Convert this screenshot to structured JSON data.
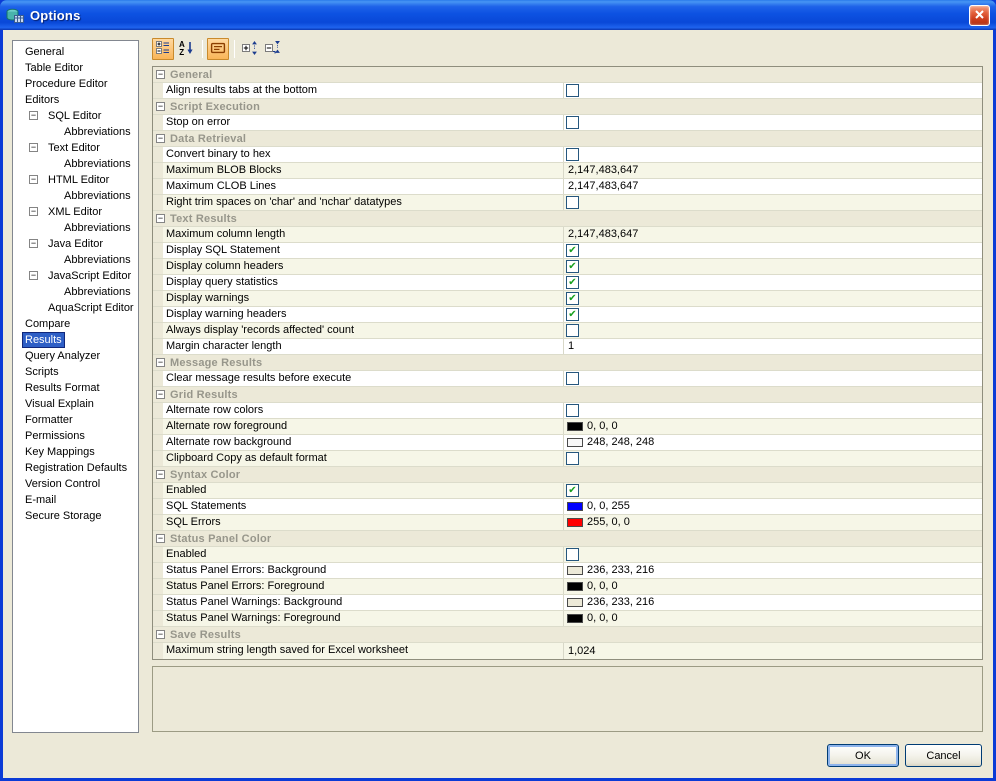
{
  "window": {
    "title": "Options"
  },
  "colors": {
    "dialog_bg": "#ECE9D8",
    "titlebar_blue": "#0D52E2",
    "selection_blue": "#2E5FC6",
    "row_alt_cream": "#F6F6E7",
    "section_header_text": "#97968B",
    "check_green": "#17A01F"
  },
  "titlebar": {
    "icon": "app-database-icon",
    "close_icon": "close-x-icon"
  },
  "toolbar": {
    "buttons": [
      {
        "name": "categorized-view",
        "icon": "categorized-icon",
        "active": true
      },
      {
        "name": "alphabetical-sort",
        "icon": "az-sort-icon",
        "active": false
      },
      {
        "name": "separator"
      },
      {
        "name": "show-description",
        "icon": "description-icon",
        "active": true
      },
      {
        "name": "separator"
      },
      {
        "name": "expand-all",
        "icon": "expand-all-icon",
        "active": false
      },
      {
        "name": "collapse-all",
        "icon": "collapse-all-icon",
        "active": false
      }
    ]
  },
  "sidebar": {
    "items": [
      {
        "label": "General",
        "level": 0
      },
      {
        "label": "Table Editor",
        "level": 0
      },
      {
        "label": "Procedure Editor",
        "level": 0
      },
      {
        "label": "Editors",
        "level": 0
      },
      {
        "label": "SQL Editor",
        "level": 1,
        "expander": "minus"
      },
      {
        "label": "Abbreviations",
        "level": 2
      },
      {
        "label": "Text Editor",
        "level": 1,
        "expander": "minus"
      },
      {
        "label": "Abbreviations",
        "level": 2
      },
      {
        "label": "HTML Editor",
        "level": 1,
        "expander": "minus"
      },
      {
        "label": "Abbreviations",
        "level": 2
      },
      {
        "label": "XML Editor",
        "level": 1,
        "expander": "minus"
      },
      {
        "label": "Abbreviations",
        "level": 2
      },
      {
        "label": "Java Editor",
        "level": 1,
        "expander": "minus"
      },
      {
        "label": "Abbreviations",
        "level": 2
      },
      {
        "label": "JavaScript Editor",
        "level": 1,
        "expander": "minus"
      },
      {
        "label": "Abbreviations",
        "level": 2
      },
      {
        "label": "AquaScript Editor",
        "level": 1
      },
      {
        "label": "Compare",
        "level": 0
      },
      {
        "label": "Results",
        "level": 0,
        "selected": true
      },
      {
        "label": "Query Analyzer",
        "level": 0
      },
      {
        "label": "Scripts",
        "level": 0
      },
      {
        "label": "Results Format",
        "level": 0
      },
      {
        "label": "Visual Explain",
        "level": 0
      },
      {
        "label": "Formatter",
        "level": 0
      },
      {
        "label": "Permissions",
        "level": 0
      },
      {
        "label": "Key Mappings",
        "level": 0
      },
      {
        "label": "Registration Defaults",
        "level": 0
      },
      {
        "label": "Version Control",
        "level": 0
      },
      {
        "label": "E-mail",
        "level": 0
      },
      {
        "label": "Secure Storage",
        "level": 0
      }
    ]
  },
  "grid": {
    "rows": [
      {
        "type": "header",
        "label": "General"
      },
      {
        "type": "item",
        "label": "Align results tabs at the bottom",
        "value": {
          "kind": "checkbox",
          "checked": false
        }
      },
      {
        "type": "header",
        "label": "Script Execution"
      },
      {
        "type": "item",
        "label": "Stop on error",
        "value": {
          "kind": "checkbox",
          "checked": false
        }
      },
      {
        "type": "header",
        "label": "Data Retrieval"
      },
      {
        "type": "item",
        "label": "Convert binary to hex",
        "value": {
          "kind": "checkbox",
          "checked": false
        }
      },
      {
        "type": "item",
        "label": "Maximum BLOB Blocks",
        "value": {
          "kind": "text",
          "text": "2,147,483,647"
        }
      },
      {
        "type": "item",
        "label": "Maximum CLOB Lines",
        "value": {
          "kind": "text",
          "text": "2,147,483,647"
        }
      },
      {
        "type": "item",
        "label": "Right trim spaces on 'char' and 'nchar' datatypes",
        "value": {
          "kind": "checkbox",
          "checked": false
        }
      },
      {
        "type": "header",
        "label": "Text Results"
      },
      {
        "type": "item",
        "label": "Maximum column length",
        "value": {
          "kind": "text",
          "text": "2,147,483,647"
        }
      },
      {
        "type": "item",
        "label": "Display SQL Statement",
        "value": {
          "kind": "checkbox",
          "checked": true
        }
      },
      {
        "type": "item",
        "label": "Display column headers",
        "value": {
          "kind": "checkbox",
          "checked": true
        }
      },
      {
        "type": "item",
        "label": "Display query statistics",
        "value": {
          "kind": "checkbox",
          "checked": true
        }
      },
      {
        "type": "item",
        "label": "Display warnings",
        "value": {
          "kind": "checkbox",
          "checked": true
        }
      },
      {
        "type": "item",
        "label": "Display warning headers",
        "value": {
          "kind": "checkbox",
          "checked": true
        }
      },
      {
        "type": "item",
        "label": "Always display 'records affected' count",
        "value": {
          "kind": "checkbox",
          "checked": false
        }
      },
      {
        "type": "item",
        "label": "Margin character length",
        "value": {
          "kind": "text",
          "text": "1"
        }
      },
      {
        "type": "header",
        "label": "Message Results"
      },
      {
        "type": "item",
        "label": "Clear message results before execute",
        "value": {
          "kind": "checkbox",
          "checked": false
        }
      },
      {
        "type": "header",
        "label": "Grid Results"
      },
      {
        "type": "item",
        "label": "Alternate row colors",
        "value": {
          "kind": "checkbox",
          "checked": false
        }
      },
      {
        "type": "item",
        "label": "Alternate row foreground",
        "value": {
          "kind": "color",
          "hex": "#000000",
          "label": "0, 0, 0"
        }
      },
      {
        "type": "item",
        "label": "Alternate row background",
        "value": {
          "kind": "color",
          "hex": "#F8F8F8",
          "label": "248, 248, 248"
        }
      },
      {
        "type": "item",
        "label": "Clipboard Copy as default format",
        "value": {
          "kind": "checkbox",
          "checked": false
        }
      },
      {
        "type": "header",
        "label": "Syntax Color"
      },
      {
        "type": "item",
        "label": "Enabled",
        "value": {
          "kind": "checkbox",
          "checked": true
        }
      },
      {
        "type": "item",
        "label": "SQL Statements",
        "value": {
          "kind": "color",
          "hex": "#0000FF",
          "label": "0, 0, 255"
        }
      },
      {
        "type": "item",
        "label": "SQL Errors",
        "value": {
          "kind": "color",
          "hex": "#FF0000",
          "label": "255, 0, 0"
        }
      },
      {
        "type": "header",
        "label": "Status Panel Color"
      },
      {
        "type": "item",
        "label": "Enabled",
        "value": {
          "kind": "checkbox",
          "checked": false
        }
      },
      {
        "type": "item",
        "label": "Status Panel Errors: Background",
        "value": {
          "kind": "color",
          "hex": "#ECE9D8",
          "label": "236, 233, 216"
        }
      },
      {
        "type": "item",
        "label": "Status Panel Errors: Foreground",
        "value": {
          "kind": "color",
          "hex": "#000000",
          "label": "0, 0, 0"
        }
      },
      {
        "type": "item",
        "label": "Status Panel Warnings: Background",
        "value": {
          "kind": "color",
          "hex": "#ECE9D8",
          "label": "236, 233, 216"
        }
      },
      {
        "type": "item",
        "label": "Status Panel Warnings: Foreground",
        "value": {
          "kind": "color",
          "hex": "#000000",
          "label": "0, 0, 0"
        }
      },
      {
        "type": "header",
        "label": "Save Results"
      },
      {
        "type": "item",
        "label": "Maximum string length saved for Excel worksheet",
        "value": {
          "kind": "text",
          "text": "1,024"
        }
      }
    ]
  },
  "buttons": {
    "ok": "OK",
    "cancel": "Cancel"
  }
}
